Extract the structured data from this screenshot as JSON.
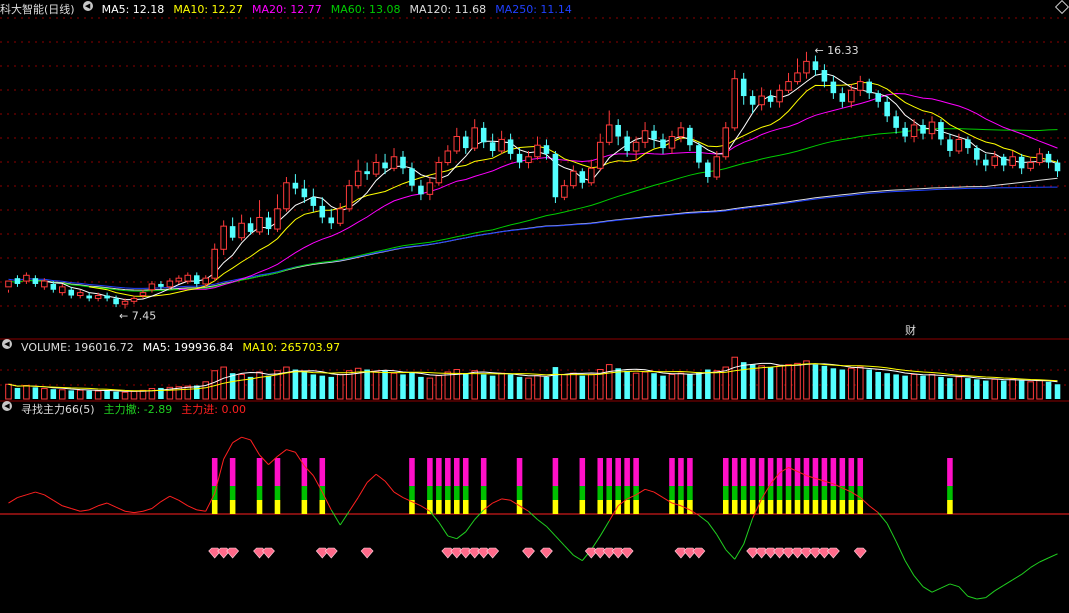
{
  "colors": {
    "bg": "#000000",
    "grid": "#8b0000",
    "up": "#ff3b3b",
    "down": "#54ffff",
    "ma5": "#ffffff",
    "ma10": "#ffff00",
    "ma20": "#ff00ff",
    "ma60": "#00cc00",
    "ma120": "#dddddd",
    "ma250": "#2040ff",
    "vol_ma5": "#ffffff",
    "vol_ma10": "#ffff00",
    "ind_red": "#ff2020",
    "ind_green": "#20d020",
    "bar_magenta": "#ff10c8",
    "bar_green": "#00c000",
    "bar_yellow": "#ffff00",
    "diamond": "#ff6a8a"
  },
  "price_panel": {
    "title": "科大智能(日线)",
    "ma": [
      {
        "label": "MA5: 12.18",
        "color": "#ffffff"
      },
      {
        "label": "MA10: 12.27",
        "color": "#ffff00"
      },
      {
        "label": "MA20: 12.77",
        "color": "#ff00ff"
      },
      {
        "label": "MA60: 13.08",
        "color": "#00cc00"
      },
      {
        "label": "MA120: 11.68",
        "color": "#dddddd"
      },
      {
        "label": "MA250: 11.14",
        "color": "#2040ff"
      }
    ],
    "high_label": "16.33",
    "low_label": "7.45",
    "fin_label": "财"
  },
  "volume_panel": {
    "items": [
      {
        "label": "VOLUME: 196016.72",
        "color": "#dddddd"
      },
      {
        "label": "MA5: 199936.84",
        "color": "#ffffff"
      },
      {
        "label": "MA10: 265703.97",
        "color": "#ffff00"
      }
    ]
  },
  "indicator_panel": {
    "items": [
      {
        "label": "寻找主力66(5)",
        "color": "#dddddd"
      },
      {
        "label": "主力撤: -2.89",
        "color": "#20d020"
      },
      {
        "label": "主力进: 0.00",
        "color": "#ff2020"
      }
    ]
  },
  "chart_data": {
    "type": "candlestick",
    "ylim": [
      6.5,
      17.5
    ],
    "candles": [
      [
        8.2,
        8.4,
        8.1,
        8.0
      ],
      [
        8.5,
        8.3,
        8.6,
        8.2
      ],
      [
        8.4,
        8.6,
        8.7,
        8.3
      ],
      [
        8.5,
        8.3,
        8.6,
        8.2
      ],
      [
        8.2,
        8.4,
        8.5,
        8.1
      ],
      [
        8.3,
        8.1,
        8.4,
        8.0
      ],
      [
        8.0,
        8.2,
        8.3,
        7.9
      ],
      [
        8.1,
        7.9,
        8.2,
        7.8
      ],
      [
        7.9,
        8.0,
        8.1,
        7.8
      ],
      [
        7.9,
        7.8,
        8.0,
        7.7
      ],
      [
        7.8,
        7.9,
        8.0,
        7.7
      ],
      [
        7.9,
        7.8,
        8.0,
        7.7
      ],
      [
        7.8,
        7.6,
        7.9,
        7.5
      ],
      [
        7.6,
        7.7,
        7.8,
        7.45
      ],
      [
        7.7,
        7.8,
        7.9,
        7.6
      ],
      [
        7.9,
        8.0,
        8.1,
        7.8
      ],
      [
        8.1,
        8.3,
        8.4,
        8.0
      ],
      [
        8.3,
        8.2,
        8.4,
        8.1
      ],
      [
        8.2,
        8.4,
        8.5,
        8.1
      ],
      [
        8.4,
        8.5,
        8.6,
        8.3
      ],
      [
        8.4,
        8.6,
        8.7,
        8.3
      ],
      [
        8.6,
        8.3,
        8.7,
        8.2
      ],
      [
        8.3,
        8.5,
        8.6,
        8.2
      ],
      [
        8.5,
        9.5,
        9.7,
        8.4
      ],
      [
        9.5,
        10.3,
        10.5,
        9.3
      ],
      [
        10.3,
        9.9,
        10.6,
        9.8
      ],
      [
        9.9,
        10.4,
        10.7,
        9.8
      ],
      [
        10.4,
        10.1,
        10.6,
        10.0
      ],
      [
        10.1,
        10.6,
        11.2,
        10.0
      ],
      [
        10.6,
        10.2,
        10.8,
        10.0
      ],
      [
        10.2,
        10.9,
        11.4,
        10.1
      ],
      [
        10.9,
        11.8,
        12.0,
        10.8
      ],
      [
        11.8,
        11.6,
        12.1,
        11.4
      ],
      [
        11.6,
        11.3,
        11.9,
        11.1
      ],
      [
        11.3,
        11.0,
        11.6,
        10.8
      ],
      [
        11.0,
        10.6,
        11.3,
        10.4
      ],
      [
        10.6,
        10.4,
        10.9,
        10.2
      ],
      [
        10.4,
        10.9,
        11.1,
        10.3
      ],
      [
        10.9,
        11.7,
        11.9,
        10.8
      ],
      [
        11.7,
        12.2,
        12.6,
        11.6
      ],
      [
        12.2,
        12.1,
        12.5,
        11.9
      ],
      [
        12.1,
        12.5,
        12.8,
        12.0
      ],
      [
        12.5,
        12.3,
        12.8,
        12.1
      ],
      [
        12.3,
        12.7,
        13.0,
        12.2
      ],
      [
        12.7,
        12.3,
        12.9,
        12.1
      ],
      [
        12.3,
        11.7,
        12.5,
        11.5
      ],
      [
        11.7,
        11.4,
        11.9,
        11.2
      ],
      [
        11.4,
        11.8,
        12.0,
        11.2
      ],
      [
        11.8,
        12.5,
        12.7,
        11.7
      ],
      [
        12.5,
        12.9,
        13.1,
        12.4
      ],
      [
        12.9,
        13.4,
        13.7,
        12.8
      ],
      [
        13.4,
        13.0,
        13.6,
        12.8
      ],
      [
        13.0,
        13.7,
        14.0,
        12.9
      ],
      [
        13.7,
        13.2,
        13.9,
        13.0
      ],
      [
        13.2,
        12.9,
        13.5,
        12.7
      ],
      [
        12.9,
        13.3,
        13.6,
        12.8
      ],
      [
        13.3,
        12.8,
        13.5,
        12.6
      ],
      [
        12.8,
        12.5,
        13.0,
        12.3
      ],
      [
        12.5,
        12.7,
        12.9,
        12.3
      ],
      [
        12.7,
        13.1,
        13.4,
        12.6
      ],
      [
        13.1,
        12.8,
        13.3,
        12.6
      ],
      [
        12.8,
        11.3,
        12.9,
        11.1
      ],
      [
        11.3,
        11.7,
        11.9,
        11.2
      ],
      [
        11.7,
        12.2,
        12.4,
        11.6
      ],
      [
        12.2,
        11.8,
        12.3,
        11.6
      ],
      [
        11.8,
        12.3,
        12.6,
        11.7
      ],
      [
        12.3,
        13.2,
        13.5,
        12.2
      ],
      [
        13.2,
        13.8,
        14.3,
        13.1
      ],
      [
        13.8,
        13.4,
        14.0,
        13.1
      ],
      [
        13.4,
        12.9,
        13.6,
        12.7
      ],
      [
        12.9,
        13.2,
        13.4,
        12.6
      ],
      [
        13.2,
        13.6,
        13.9,
        13.0
      ],
      [
        13.6,
        13.3,
        13.8,
        13.0
      ],
      [
        13.3,
        13.0,
        13.5,
        12.8
      ],
      [
        13.0,
        13.4,
        13.6,
        12.8
      ],
      [
        13.4,
        13.7,
        13.9,
        13.2
      ],
      [
        13.7,
        13.1,
        13.8,
        12.9
      ],
      [
        13.1,
        12.5,
        13.2,
        12.3
      ],
      [
        12.5,
        12.0,
        12.6,
        11.8
      ],
      [
        12.0,
        12.7,
        12.9,
        11.9
      ],
      [
        12.7,
        13.7,
        13.9,
        12.6
      ],
      [
        13.7,
        15.4,
        15.7,
        13.6
      ],
      [
        15.4,
        14.8,
        15.6,
        14.5
      ],
      [
        14.8,
        14.5,
        15.0,
        14.2
      ],
      [
        14.5,
        14.8,
        15.1,
        14.3
      ],
      [
        14.8,
        14.6,
        15.0,
        14.4
      ],
      [
        14.6,
        15.0,
        15.2,
        14.4
      ],
      [
        15.0,
        15.3,
        15.6,
        14.9
      ],
      [
        15.3,
        15.6,
        16.1,
        15.2
      ],
      [
        15.6,
        16.0,
        16.33,
        15.4
      ],
      [
        16.0,
        15.7,
        16.2,
        15.5
      ],
      [
        15.7,
        15.3,
        15.9,
        15.1
      ],
      [
        15.3,
        14.9,
        15.5,
        14.7
      ],
      [
        14.9,
        14.6,
        15.1,
        14.4
      ],
      [
        14.6,
        15.0,
        15.2,
        14.4
      ],
      [
        15.0,
        15.3,
        15.5,
        14.8
      ],
      [
        15.3,
        14.9,
        15.4,
        14.7
      ],
      [
        14.9,
        14.6,
        15.0,
        14.4
      ],
      [
        14.6,
        14.1,
        14.8,
        13.9
      ],
      [
        14.1,
        13.7,
        14.3,
        13.5
      ],
      [
        13.7,
        13.4,
        13.9,
        13.2
      ],
      [
        13.4,
        13.8,
        14.0,
        13.2
      ],
      [
        13.8,
        13.5,
        14.0,
        13.3
      ],
      [
        13.5,
        13.9,
        14.1,
        13.3
      ],
      [
        13.9,
        13.3,
        14.0,
        13.1
      ],
      [
        13.3,
        12.9,
        13.5,
        12.7
      ],
      [
        12.9,
        13.3,
        13.5,
        12.8
      ],
      [
        13.3,
        13.0,
        13.4,
        12.8
      ],
      [
        13.0,
        12.6,
        13.1,
        12.4
      ],
      [
        12.6,
        12.4,
        12.8,
        12.2
      ],
      [
        12.4,
        12.7,
        12.9,
        12.3
      ],
      [
        12.7,
        12.4,
        12.8,
        12.2
      ],
      [
        12.4,
        12.7,
        12.9,
        12.3
      ],
      [
        12.7,
        12.3,
        12.8,
        12.1
      ],
      [
        12.3,
        12.5,
        12.7,
        12.2
      ],
      [
        12.5,
        12.8,
        13.0,
        12.4
      ],
      [
        12.8,
        12.5,
        12.9,
        12.3
      ],
      [
        12.5,
        12.2,
        12.6,
        12.0
      ]
    ],
    "volume": [
      120,
      90,
      110,
      95,
      85,
      80,
      75,
      70,
      72,
      68,
      65,
      70,
      60,
      55,
      62,
      70,
      85,
      90,
      95,
      100,
      105,
      110,
      140,
      230,
      260,
      210,
      200,
      180,
      220,
      190,
      230,
      260,
      240,
      220,
      200,
      190,
      180,
      200,
      230,
      250,
      240,
      220,
      230,
      210,
      200,
      220,
      180,
      170,
      190,
      220,
      240,
      210,
      230,
      200,
      190,
      210,
      200,
      180,
      170,
      190,
      180,
      260,
      200,
      210,
      190,
      200,
      240,
      280,
      250,
      230,
      210,
      220,
      210,
      190,
      200,
      210,
      200,
      220,
      240,
      230,
      260,
      340,
      300,
      280,
      270,
      260,
      270,
      280,
      290,
      310,
      280,
      270,
      250,
      240,
      250,
      260,
      240,
      220,
      210,
      200,
      190,
      200,
      190,
      200,
      180,
      170,
      180,
      170,
      160,
      150,
      160,
      150,
      160,
      150,
      140,
      150,
      140,
      120
    ],
    "volume_ylim": [
      0,
      350
    ],
    "indicator": {
      "zero_level": 0,
      "ylim": [
        -7,
        7
      ],
      "line": [
        0.8,
        1.2,
        1.4,
        1.6,
        1.4,
        1.0,
        0.6,
        0.4,
        0.2,
        0.3,
        0.6,
        0.8,
        0.5,
        0.2,
        0.1,
        0.2,
        0.4,
        0.9,
        1.3,
        1.0,
        0.6,
        0.3,
        0.2,
        1.5,
        4.0,
        5.2,
        5.6,
        5.4,
        4.3,
        3.6,
        4.2,
        4.7,
        4.5,
        3.5,
        2.8,
        1.6,
        0.3,
        -0.8,
        0.2,
        1.2,
        2.3,
        2.9,
        2.4,
        1.6,
        1.2,
        0.9,
        0.6,
        0.2,
        -0.6,
        -1.6,
        -1.8,
        -1.3,
        -0.4,
        0.3,
        0.8,
        1.1,
        1.0,
        0.6,
        0.2,
        -0.4,
        -0.9,
        -1.6,
        -2.3,
        -3.0,
        -3.4,
        -2.6,
        -1.6,
        -0.5,
        0.6,
        1.1,
        1.4,
        1.8,
        1.6,
        1.2,
        0.8,
        0.6,
        0.3,
        -0.1,
        -0.6,
        -1.5,
        -2.6,
        -3.3,
        -2.2,
        -0.3,
        1.1,
        2.2,
        3.0,
        3.4,
        3.1,
        2.8,
        2.6,
        2.4,
        2.2,
        1.9,
        1.6,
        1.2,
        0.6,
        0.1,
        -0.7,
        -2.0,
        -3.4,
        -4.5,
        -5.3,
        -5.7,
        -5.4,
        -5.1,
        -5.3,
        -6.0,
        -6.2,
        -6.1,
        -5.6,
        -5.2,
        -4.8,
        -4.4,
        -3.9,
        -3.5,
        -3.2,
        -2.9
      ],
      "signal_bars": [
        23,
        25,
        28,
        30,
        33,
        35,
        45,
        47,
        48,
        49,
        50,
        51,
        53,
        57,
        61,
        64,
        66,
        67,
        68,
        69,
        70,
        74,
        75,
        76,
        80,
        81,
        82,
        83,
        84,
        85,
        86,
        87,
        88,
        89,
        90,
        91,
        92,
        93,
        94,
        95,
        105
      ],
      "gems": [
        23,
        24,
        25,
        28,
        29,
        35,
        36,
        40,
        49,
        50,
        51,
        52,
        53,
        54,
        58,
        60,
        65,
        66,
        67,
        68,
        69,
        75,
        76,
        77,
        83,
        84,
        85,
        86,
        87,
        88,
        89,
        90,
        91,
        92,
        95
      ]
    }
  }
}
